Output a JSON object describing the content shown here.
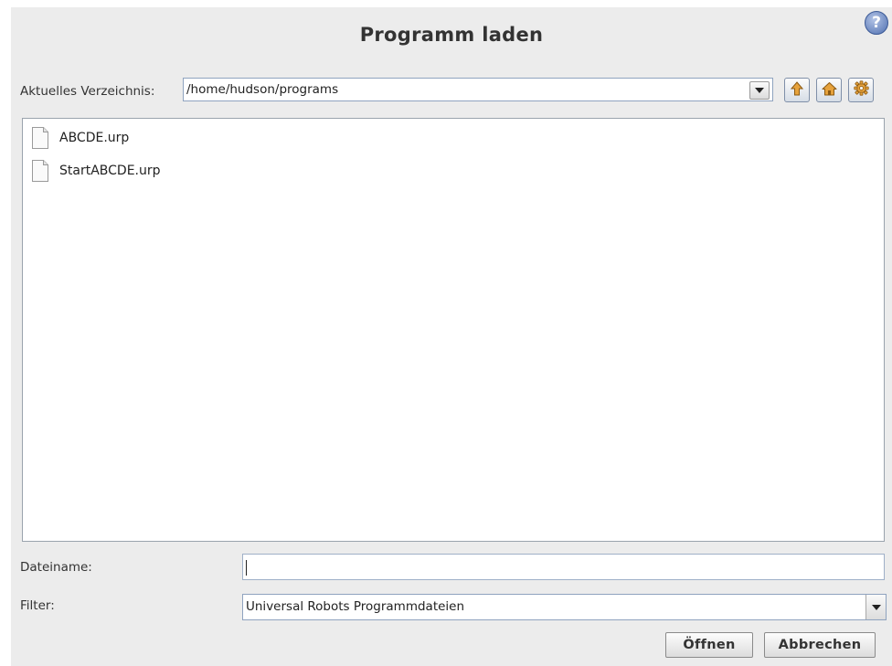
{
  "dialog": {
    "title": "Programm laden",
    "help_icon": "question-mark-icon",
    "help_glyph": "?"
  },
  "directory": {
    "label": "Aktuelles Verzeichnis:",
    "current": "/home/hudson/programs",
    "toolbar_icons": [
      "up-arrow-icon",
      "home-icon",
      "gear-icon"
    ]
  },
  "files": [
    {
      "name": "ABCDE.urp",
      "icon": "file-icon"
    },
    {
      "name": "StartABCDE.urp",
      "icon": "file-icon"
    }
  ],
  "filename": {
    "label": "Dateiname:",
    "value": ""
  },
  "filter": {
    "label": "Filter:",
    "selected": "Universal Robots Programmdateien"
  },
  "buttons": {
    "open": "Öffnen",
    "cancel": "Abbrechen"
  },
  "colors": {
    "accent": "#4f6fb0",
    "dialog_bg": "#ececec"
  }
}
